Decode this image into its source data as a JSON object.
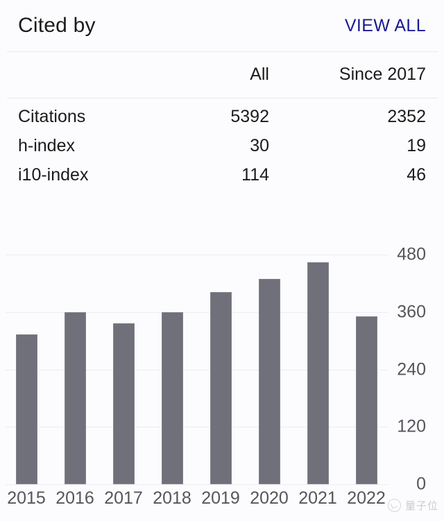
{
  "header": {
    "title": "Cited by",
    "view_all_label": "VIEW ALL"
  },
  "table": {
    "columns": [
      "",
      "All",
      "Since 2017"
    ],
    "rows": [
      {
        "label": "Citations",
        "all": "5392",
        "since": "2352"
      },
      {
        "label": "h-index",
        "all": "30",
        "since": "19"
      },
      {
        "label": "i10-index",
        "all": "114",
        "since": "46"
      }
    ]
  },
  "colors": {
    "link": "#1a1a8f",
    "bar": "#70707a",
    "bar_border": "#83838c",
    "gridline": "#ececf2",
    "background": "#fcfcfe",
    "text": "#1b1b1b",
    "axis_text": "#55555c"
  },
  "watermark": {
    "text": "量子位"
  },
  "chart_data": {
    "type": "bar",
    "title": "",
    "xlabel": "",
    "ylabel": "",
    "categories": [
      "2015",
      "2016",
      "2017",
      "2018",
      "2019",
      "2020",
      "2021",
      "2022"
    ],
    "values": [
      313,
      360,
      337,
      360,
      402,
      429,
      464,
      351
    ],
    "ylim": [
      0,
      480
    ],
    "yticks": [
      0,
      120,
      240,
      360,
      480
    ],
    "ytick_labels": [
      "0",
      "120",
      "240",
      "360",
      "480"
    ],
    "grid": true,
    "legend": "none"
  }
}
